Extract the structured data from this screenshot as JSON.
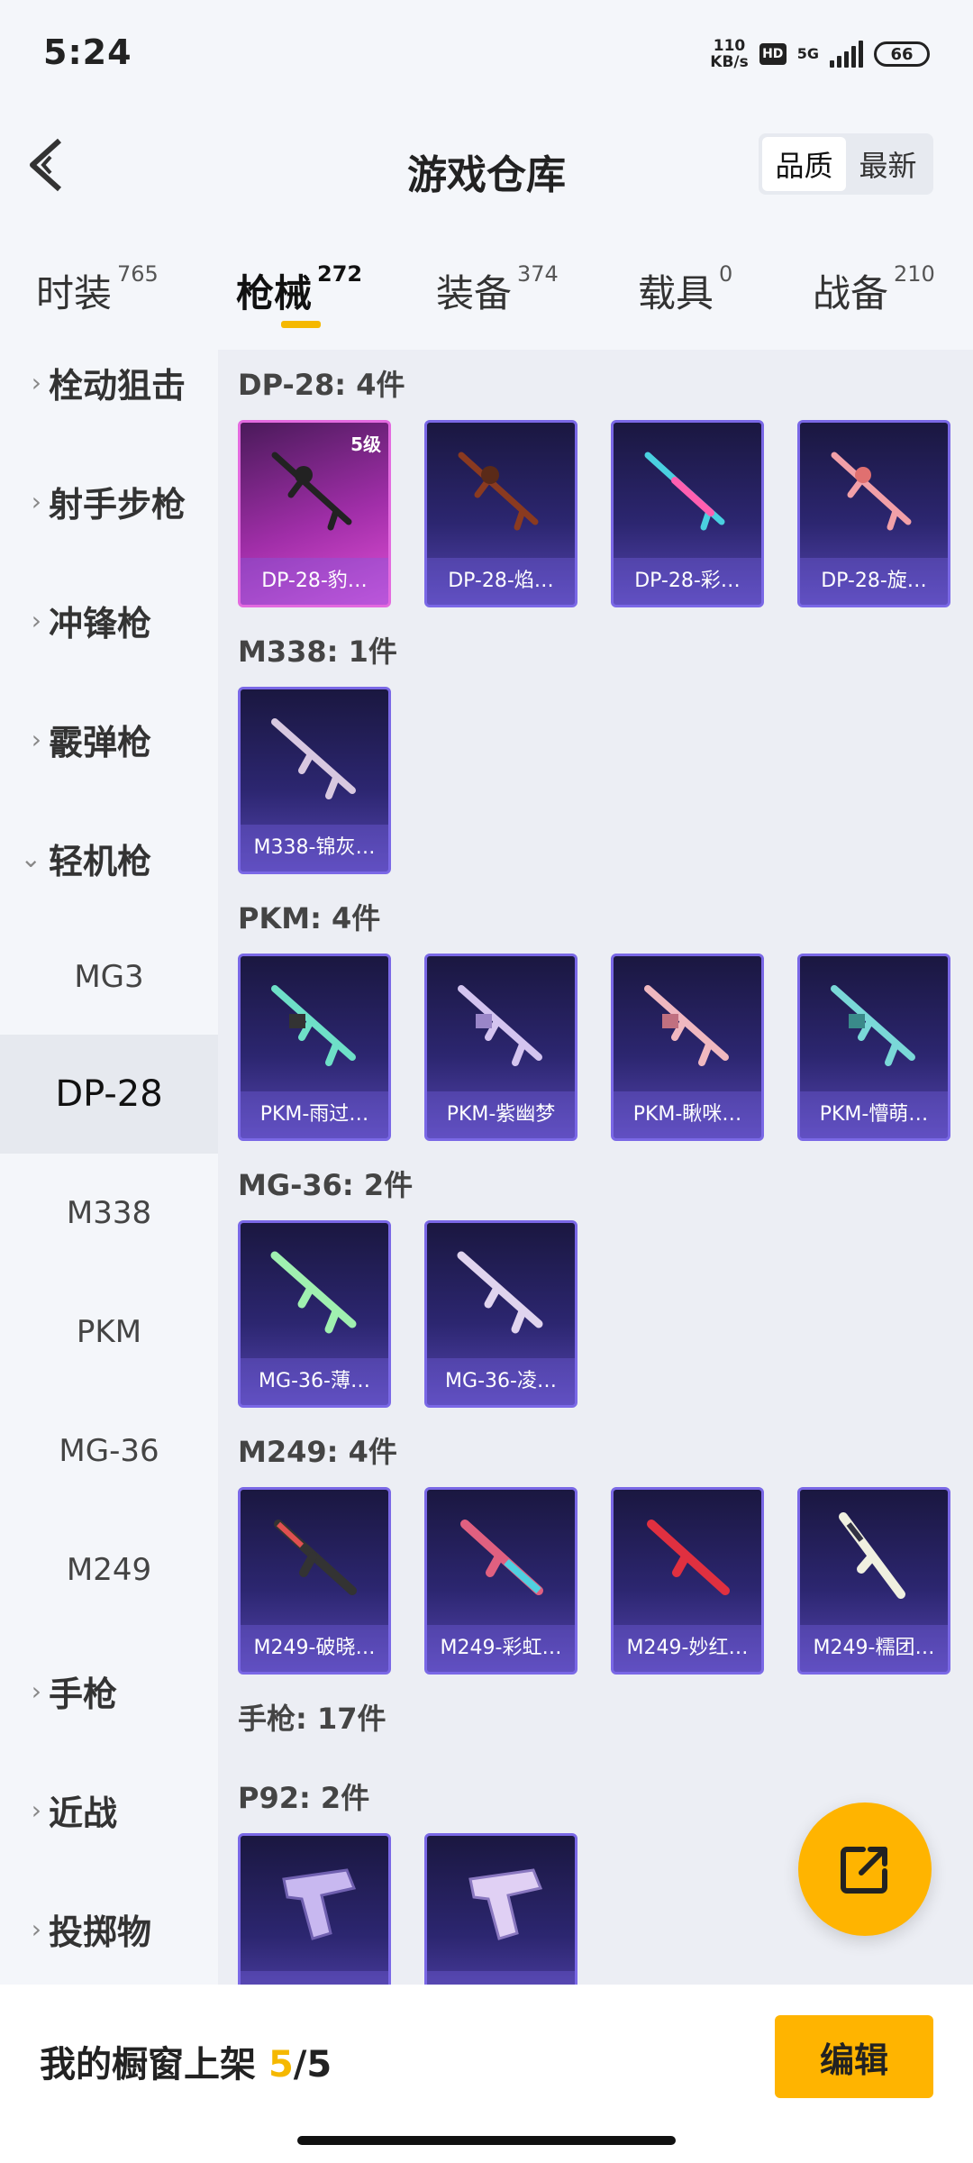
{
  "status_bar": {
    "time": "5:24",
    "speed_value": "110",
    "speed_unit": "KB/s",
    "hd": "HD",
    "network": "5G",
    "battery": "66"
  },
  "header": {
    "title": "游戏仓库",
    "sort_options": [
      "品质",
      "最新"
    ],
    "active_sort": "品质"
  },
  "tabs": [
    {
      "label": "时装",
      "count": "765"
    },
    {
      "label": "枪械",
      "count": "272",
      "active": true
    },
    {
      "label": "装备",
      "count": "374"
    },
    {
      "label": "载具",
      "count": "0"
    },
    {
      "label": "战备",
      "count": "210"
    }
  ],
  "sidebar": {
    "categories": [
      "栓动狙击",
      "射手步枪",
      "冲锋枪",
      "霰弹枪",
      "轻机枪",
      "手枪",
      "近战",
      "投掷物"
    ],
    "subitems": [
      "MG3",
      "DP-28",
      "M338",
      "PKM",
      "MG-36",
      "M249"
    ],
    "selected": "DP-28"
  },
  "sections": [
    {
      "title": "DP-28: 4件",
      "items": [
        "DP-28-豹…",
        "DP-28-焰…",
        "DP-28-彩…",
        "DP-28-旋…"
      ]
    },
    {
      "title": "M338: 1件",
      "items": [
        "M338-锦灰…"
      ]
    },
    {
      "title": "PKM: 4件",
      "items": [
        "PKM-雨过…",
        "PKM-紫幽梦",
        "PKM-瞅咪…",
        "PKM-懵萌…"
      ]
    },
    {
      "title": "MG-36: 2件",
      "items": [
        "MG-36-薄…",
        "MG-36-凌…"
      ]
    },
    {
      "title": "M249: 4件",
      "items": [
        "M249-破晓…",
        "M249-彩虹…",
        "M249-妙红…",
        "M249-糯团…"
      ]
    },
    {
      "title": "手枪: 17件",
      "items": []
    },
    {
      "title": "P92: 2件",
      "items": [
        "",
        ""
      ]
    }
  ],
  "badge_level": "5级",
  "bottom": {
    "label": "我的橱窗上架",
    "current": "5",
    "separator": "/",
    "total": "5",
    "edit_label": "编辑"
  },
  "colors": {
    "accent": "#ffb400",
    "card_purple": "#2c2670",
    "card_pink": "#a02ea8"
  }
}
